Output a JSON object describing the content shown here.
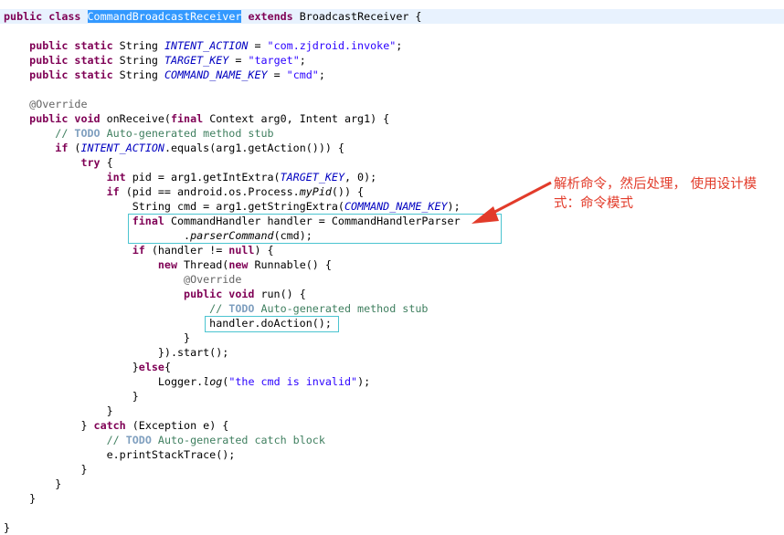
{
  "code": {
    "class_decl": {
      "kw1": "public",
      "kw2": "class",
      "name": "CommandBroadcastReceiver",
      "kw3": "extends",
      "parent": "BroadcastReceiver {"
    },
    "field1": {
      "mods": "public static",
      "type": " String ",
      "name": "INTENT_ACTION",
      "eq": " = ",
      "value": "\"com.zjdroid.invoke\"",
      "end": ";"
    },
    "field2": {
      "mods": "public static",
      "type": " String ",
      "name": "TARGET_KEY",
      "eq": " = ",
      "value": "\"target\"",
      "end": ";"
    },
    "field3": {
      "mods": "public static",
      "type": " String ",
      "name": "COMMAND_NAME_KEY",
      "eq": " = ",
      "value": "\"cmd\"",
      "end": ";"
    },
    "override1": "@Override",
    "onreceive": {
      "kw": "public void",
      "rest1": " onReceive(",
      "final": "final",
      "rest2": " Context arg0, Intent arg1) {"
    },
    "todo1": {
      "slashes": "// ",
      "todo": "TODO",
      "text": " Auto-generated method stub"
    },
    "if1": {
      "kw": "if",
      "rest1": " (",
      "field": "INTENT_ACTION",
      "rest2": ".equals(arg1.getAction())) {"
    },
    "try": {
      "kw": "try",
      "rest": " {"
    },
    "pidline": {
      "kw": "int",
      "rest1": " pid = arg1.getIntExtra(",
      "field": "TARGET_KEY",
      "rest2": ", 0);"
    },
    "if2": {
      "kw": "if",
      "rest1": " (pid == android.os.Process.",
      "method": "myPid",
      "rest2": "()) {"
    },
    "cmdline": {
      "rest1": "String cmd = arg1.getStringExtra(",
      "field": "COMMAND_NAME_KEY",
      "rest2": ");"
    },
    "handlerline": {
      "kw": "final",
      "rest": " CommandHandler handler = CommandHandlerParser"
    },
    "parserline": {
      "rest1": ".",
      "method": "parserCommand",
      "rest2": "(cmd);"
    },
    "if3": {
      "kw": "if",
      "rest1": " (handler != ",
      "null": "null",
      "rest2": ") {"
    },
    "thread": {
      "kw": "new",
      "rest1": " Thread(",
      "kw2": "new",
      "rest2": " Runnable() {"
    },
    "override2": "@Override",
    "run": {
      "kw": "public void",
      "rest": " run() {"
    },
    "todo2": {
      "slashes": "// ",
      "todo": "TODO",
      "text": " Auto-generated method stub"
    },
    "doaction": "handler.doAction();",
    "close1": "}",
    "start": "}).start();",
    "else": {
      "brace": "}",
      "kw": "else",
      "rest": "{"
    },
    "logger": {
      "rest1": "Logger.",
      "method": "log",
      "rest2": "(",
      "str": "\"the cmd is invalid\"",
      "rest3": ");"
    },
    "close2": "}",
    "close3": "}",
    "catch": {
      "brace": "} ",
      "kw": "catch",
      "rest": " (Exception e) {"
    },
    "todo3": {
      "slashes": "// ",
      "todo": "TODO",
      "text": " Auto-generated catch block"
    },
    "stack": "e.printStackTrace();",
    "close4": "}",
    "close5": "}",
    "close6": "}",
    "close7": "}"
  },
  "annotation": {
    "text": "解析命令，然后处理， 使用设计模式：命令模式",
    "color": "#e23b2a"
  }
}
